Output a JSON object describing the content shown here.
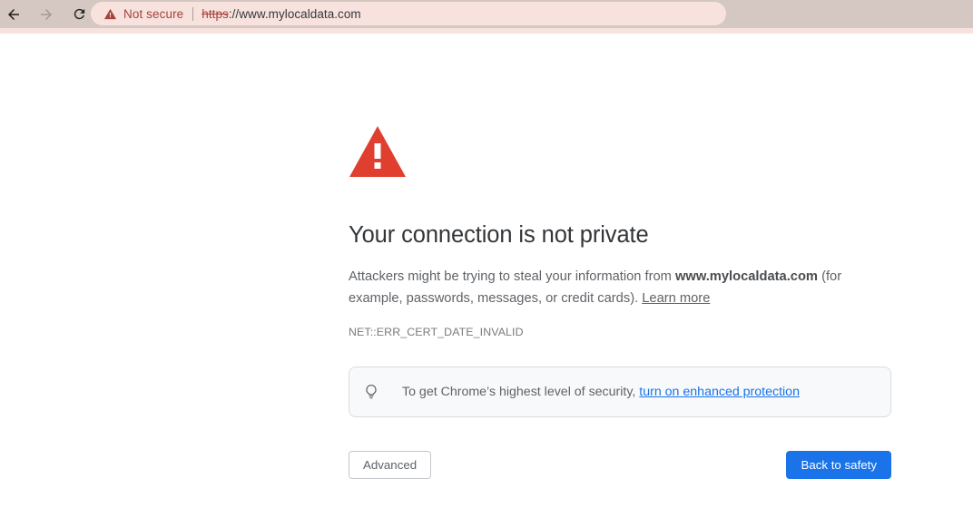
{
  "browser": {
    "nav": {
      "back_label": "Back",
      "forward_label": "Forward",
      "reload_label": "Reload"
    },
    "omnibox": {
      "security_label": "Not secure",
      "url_scheme": "https",
      "url_rest": "://www.mylocaldata.com",
      "full_url": "https://www.mylocaldata.com"
    },
    "colors": {
      "toolbar_bg": "#d5c7c1",
      "omnibox_bg": "#f7e2de",
      "not_secure_text": "#a4433c"
    }
  },
  "interstitial": {
    "icon_name": "error-triangle-icon",
    "icon_color": "#e03e2f",
    "heading": "Your connection is not private",
    "paragraph": {
      "before_host": "Attackers might be trying to steal your information from ",
      "host": "www.mylocaldata.com",
      "after_host": " (for example, passwords, messages, or credit cards). ",
      "learn_more": "Learn more"
    },
    "error_code": "NET::ERR_CERT_DATE_INVALID",
    "enhanced_protection": {
      "icon_name": "lightbulb-icon",
      "text": "To get Chrome’s highest level of security, ",
      "link": "turn on enhanced protection",
      "link_color": "#1a73e8",
      "box_bg": "#f8f9fa",
      "box_border": "#dadce0"
    },
    "buttons": {
      "advanced": "Advanced",
      "back_to_safety": "Back to safety",
      "primary_color": "#1a73e8"
    }
  }
}
